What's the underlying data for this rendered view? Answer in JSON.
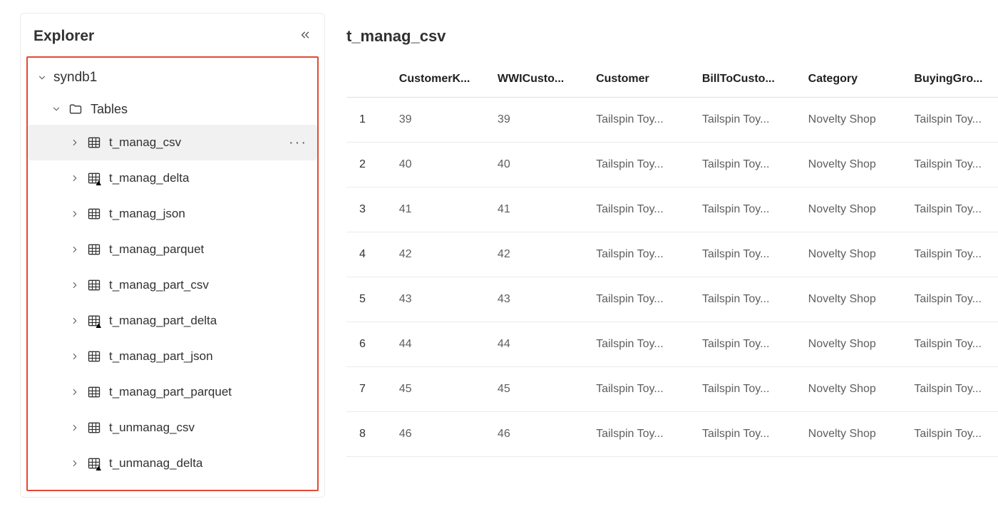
{
  "sidebar": {
    "title": "Explorer",
    "root": {
      "label": "syndb1",
      "expanded": true
    },
    "tablesNode": {
      "label": "Tables",
      "expanded": true
    },
    "tables": [
      {
        "label": "t_manag_csv",
        "selected": true,
        "deltaBadge": false
      },
      {
        "label": "t_manag_delta",
        "selected": false,
        "deltaBadge": true
      },
      {
        "label": "t_manag_json",
        "selected": false,
        "deltaBadge": false
      },
      {
        "label": "t_manag_parquet",
        "selected": false,
        "deltaBadge": false
      },
      {
        "label": "t_manag_part_csv",
        "selected": false,
        "deltaBadge": false
      },
      {
        "label": "t_manag_part_delta",
        "selected": false,
        "deltaBadge": true
      },
      {
        "label": "t_manag_part_json",
        "selected": false,
        "deltaBadge": false
      },
      {
        "label": "t_manag_part_parquet",
        "selected": false,
        "deltaBadge": false
      },
      {
        "label": "t_unmanag_csv",
        "selected": false,
        "deltaBadge": false
      },
      {
        "label": "t_unmanag_delta",
        "selected": false,
        "deltaBadge": true
      }
    ]
  },
  "main": {
    "title": "t_manag_csv",
    "columns": [
      "CustomerK...",
      "WWICusto...",
      "Customer",
      "BillToCusto...",
      "Category",
      "BuyingGro..."
    ],
    "rows": [
      {
        "n": "1",
        "ck": "39",
        "wwi": "39",
        "cust": "Tailspin Toy...",
        "bill": "Tailspin Toy...",
        "cat": "Novelty Shop",
        "bg": "Tailspin Toy..."
      },
      {
        "n": "2",
        "ck": "40",
        "wwi": "40",
        "cust": "Tailspin Toy...",
        "bill": "Tailspin Toy...",
        "cat": "Novelty Shop",
        "bg": "Tailspin Toy..."
      },
      {
        "n": "3",
        "ck": "41",
        "wwi": "41",
        "cust": "Tailspin Toy...",
        "bill": "Tailspin Toy...",
        "cat": "Novelty Shop",
        "bg": "Tailspin Toy..."
      },
      {
        "n": "4",
        "ck": "42",
        "wwi": "42",
        "cust": "Tailspin Toy...",
        "bill": "Tailspin Toy...",
        "cat": "Novelty Shop",
        "bg": "Tailspin Toy..."
      },
      {
        "n": "5",
        "ck": "43",
        "wwi": "43",
        "cust": "Tailspin Toy...",
        "bill": "Tailspin Toy...",
        "cat": "Novelty Shop",
        "bg": "Tailspin Toy..."
      },
      {
        "n": "6",
        "ck": "44",
        "wwi": "44",
        "cust": "Tailspin Toy...",
        "bill": "Tailspin Toy...",
        "cat": "Novelty Shop",
        "bg": "Tailspin Toy..."
      },
      {
        "n": "7",
        "ck": "45",
        "wwi": "45",
        "cust": "Tailspin Toy...",
        "bill": "Tailspin Toy...",
        "cat": "Novelty Shop",
        "bg": "Tailspin Toy..."
      },
      {
        "n": "8",
        "ck": "46",
        "wwi": "46",
        "cust": "Tailspin Toy...",
        "bill": "Tailspin Toy...",
        "cat": "Novelty Shop",
        "bg": "Tailspin Toy..."
      }
    ]
  }
}
